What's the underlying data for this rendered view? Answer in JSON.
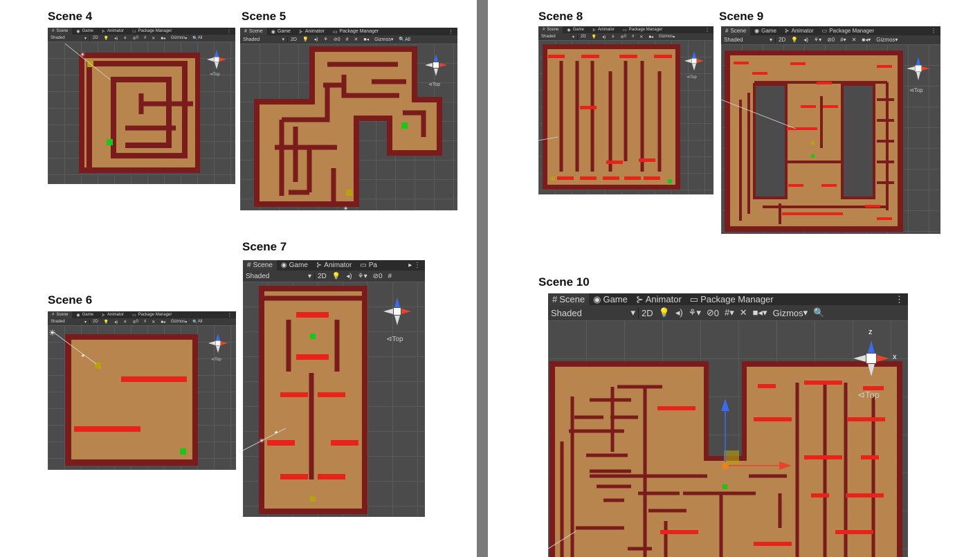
{
  "scenes": [
    {
      "id": 4,
      "title": "Scene 4"
    },
    {
      "id": 5,
      "title": "Scene 5"
    },
    {
      "id": 6,
      "title": "Scene 6"
    },
    {
      "id": 7,
      "title": "Scene 7"
    },
    {
      "id": 8,
      "title": "Scene 8"
    },
    {
      "id": 9,
      "title": "Scene 9"
    },
    {
      "id": 10,
      "title": "Scene 10"
    }
  ],
  "editor": {
    "tabs": {
      "scene": "Scene",
      "game": "Game",
      "animator": "Animator",
      "package_manager": "Package Manager",
      "package_manager_truncated": "Pa"
    },
    "toolbar": {
      "draw_mode": "Shaded",
      "mode_2d": "2D",
      "hidden_count": "0",
      "gizmos": "Gizmos",
      "search_placeholder": "All"
    },
    "axis": {
      "z": "z",
      "x": "x",
      "view": "Top"
    }
  },
  "colors": {
    "floor": "#b7854d",
    "wall": "#7a1c1c",
    "red_bar": "#e8231b",
    "goal_green": "#19c619",
    "start_yellow": "#b7a10f",
    "viewport_bg": "#4b4b4b",
    "grid": "#5a5a5a"
  }
}
